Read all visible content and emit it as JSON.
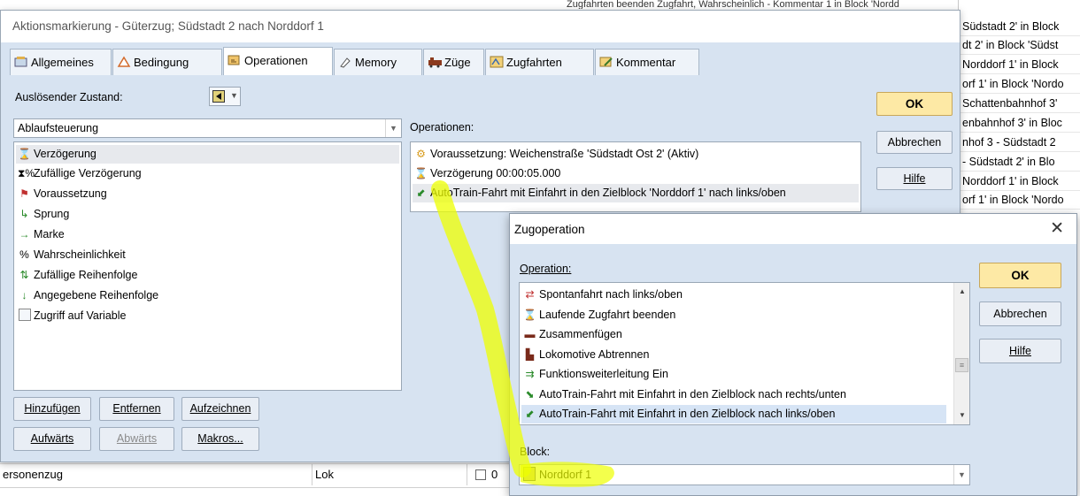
{
  "background": {
    "top_text": "Zugfahrten beenden Zugfahrt, Wahrscheinlich - Kommentar 1 in Block 'Nordd",
    "right_rows": [
      "Südstadt 2' in Block",
      "dt 2' in Block 'Südst",
      "Norddorf 1' in Block",
      "orf 1' in Block 'Nordo",
      "Schattenbahnhof 3'",
      "enbahnhof 3' in Bloc",
      "nhof 3 - Südstadt 2",
      "- Südstadt 2' in Blo",
      "Norddorf 1' in Block",
      "orf 1' in Block 'Nordo"
    ],
    "row": {
      "col1": "ersonenzug",
      "col2": "Lok",
      "col3": "0"
    }
  },
  "main_dialog": {
    "title": "Aktionsmarkierung - Güterzug; Südstadt 2 nach Norddorf 1",
    "tabs": [
      {
        "label": "Allgemeines",
        "icon": "general-icon"
      },
      {
        "label": "Bedingung",
        "icon": "condition-icon"
      },
      {
        "label": "Operationen",
        "icon": "operations-icon"
      },
      {
        "label": "Memory",
        "icon": "memory-icon"
      },
      {
        "label": "Züge",
        "icon": "trains-icon"
      },
      {
        "label": "Zugfahrten",
        "icon": "train-routes-icon"
      },
      {
        "label": "Kommentar",
        "icon": "comment-icon"
      }
    ],
    "trigger_label": "Auslösender Zustand:",
    "category_value": "Ablaufsteuerung",
    "operations_label": "Operationen:",
    "available_items": [
      {
        "label": "Verzögerung",
        "icon": "hourglass-icon",
        "selected": true
      },
      {
        "label": "Zufällige Verzögerung",
        "icon": "random-delay-icon"
      },
      {
        "label": "Voraussetzung",
        "icon": "precondition-icon"
      },
      {
        "label": "Sprung",
        "icon": "jump-icon"
      },
      {
        "label": "Marke",
        "icon": "mark-icon"
      },
      {
        "label": "Wahrscheinlichkeit",
        "icon": "percent-icon"
      },
      {
        "label": "Zufällige Reihenfolge",
        "icon": "random-order-icon"
      },
      {
        "label": "Angegebene Reihenfolge",
        "icon": "given-order-icon"
      },
      {
        "label": "Zugriff auf Variable",
        "icon": "variable-icon"
      }
    ],
    "operations": [
      {
        "label": "Voraussetzung: Weichenstraße 'Südstadt Ost 2' (Aktiv)",
        "icon": "precondition-icon"
      },
      {
        "label": "Verzögerung 00:00:05.000",
        "icon": "hourglass-icon"
      },
      {
        "label": "AutoTrain-Fahrt mit Einfahrt in den Zielblock 'Norddorf 1' nach links/oben",
        "icon": "autotrain-icon"
      }
    ],
    "buttons": {
      "add": "Hinzufügen",
      "remove": "Entfernen",
      "record": "Aufzeichnen",
      "up": "Aufwärts",
      "down": "Abwärts",
      "macros": "Makros...",
      "ok": "OK",
      "cancel": "Abbrechen",
      "help": "Hilfe"
    }
  },
  "zug_dialog": {
    "title": "Zugoperation",
    "operation_label": "Operation:",
    "items": [
      {
        "label": "Spontanfahrt nach links/oben",
        "icon": "spontaneous-ride-icon"
      },
      {
        "label": "Laufende Zugfahrt beenden",
        "icon": "stop-route-icon"
      },
      {
        "label": "Zusammenfügen",
        "icon": "couple-icon"
      },
      {
        "label": "Lokomotive Abtrennen",
        "icon": "decouple-icon"
      },
      {
        "label": "Funktionsweiterleitung Ein",
        "icon": "function-forward-icon"
      },
      {
        "label": "AutoTrain-Fahrt mit Einfahrt in den Zielblock nach rechts/unten",
        "icon": "autotrain-icon"
      },
      {
        "label": "AutoTrain-Fahrt mit Einfahrt in den Zielblock nach links/oben",
        "icon": "autotrain-icon",
        "selected": true
      }
    ],
    "block_label": "Block:",
    "block_value": "Norddorf 1",
    "buttons": {
      "ok": "OK",
      "cancel": "Abbrechen",
      "help": "Hilfe"
    }
  },
  "colors": {
    "dialog_bg": "#d7e3f1",
    "ok_button": "#fde9a5",
    "highlight": "#f0ff00"
  }
}
